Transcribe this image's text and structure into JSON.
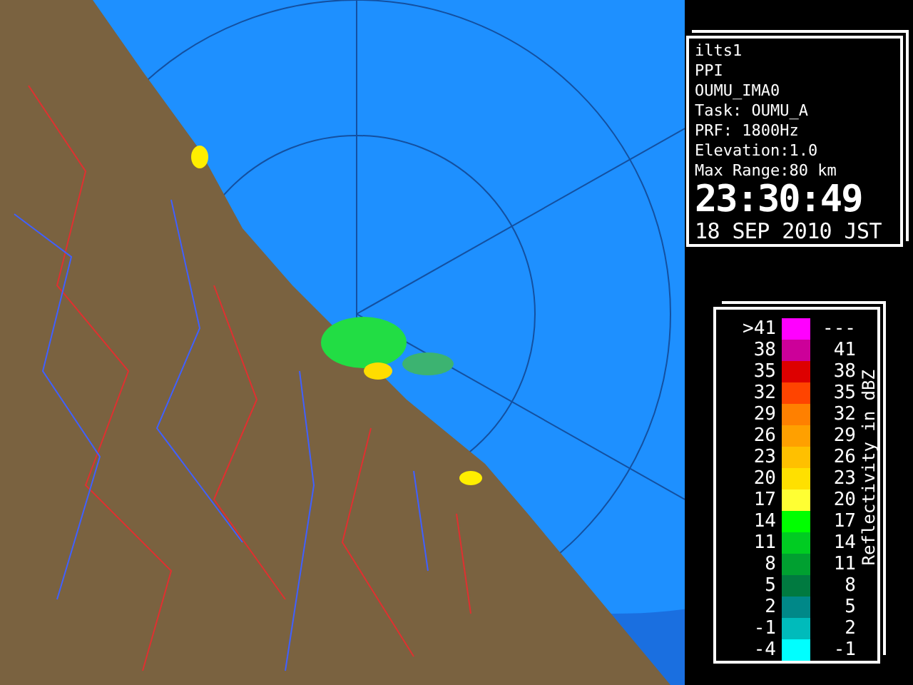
{
  "info": {
    "lines": [
      "ilts1",
      "PPI",
      "OUMU_IMA0",
      "Task: OUMU_A",
      "PRF: 1800Hz",
      "Elevation:1.0",
      "Max Range:80 km"
    ],
    "time": "23:30:49",
    "date": "18 SEP 2010 JST"
  },
  "legend": {
    "title": "Reflectivity in dBZ",
    "rows": [
      {
        "label": ">41",
        "upper": "---",
        "color": "#ff00ff"
      },
      {
        "label": "38",
        "upper": "41",
        "color": "#cc0099"
      },
      {
        "label": "35",
        "upper": "38",
        "color": "#dd0000"
      },
      {
        "label": "32",
        "upper": "35",
        "color": "#ff4400"
      },
      {
        "label": "29",
        "upper": "32",
        "color": "#ff8000"
      },
      {
        "label": "26",
        "upper": "29",
        "color": "#ffa000"
      },
      {
        "label": "23",
        "upper": "26",
        "color": "#ffc000"
      },
      {
        "label": "20",
        "upper": "23",
        "color": "#ffe000"
      },
      {
        "label": "17",
        "upper": "20",
        "color": "#ffff33"
      },
      {
        "label": "14",
        "upper": "17",
        "color": "#00ff00"
      },
      {
        "label": "11",
        "upper": "14",
        "color": "#00cc22"
      },
      {
        "label": "8",
        "upper": "11",
        "color": "#00a030"
      },
      {
        "label": "5",
        "upper": "8",
        "color": "#007a40"
      },
      {
        "label": "2",
        "upper": "5",
        "color": "#008888"
      },
      {
        "label": "-1",
        "upper": "2",
        "color": "#00bbbb"
      },
      {
        "label": "-4",
        "upper": "-1",
        "color": "#00ffff"
      }
    ]
  }
}
